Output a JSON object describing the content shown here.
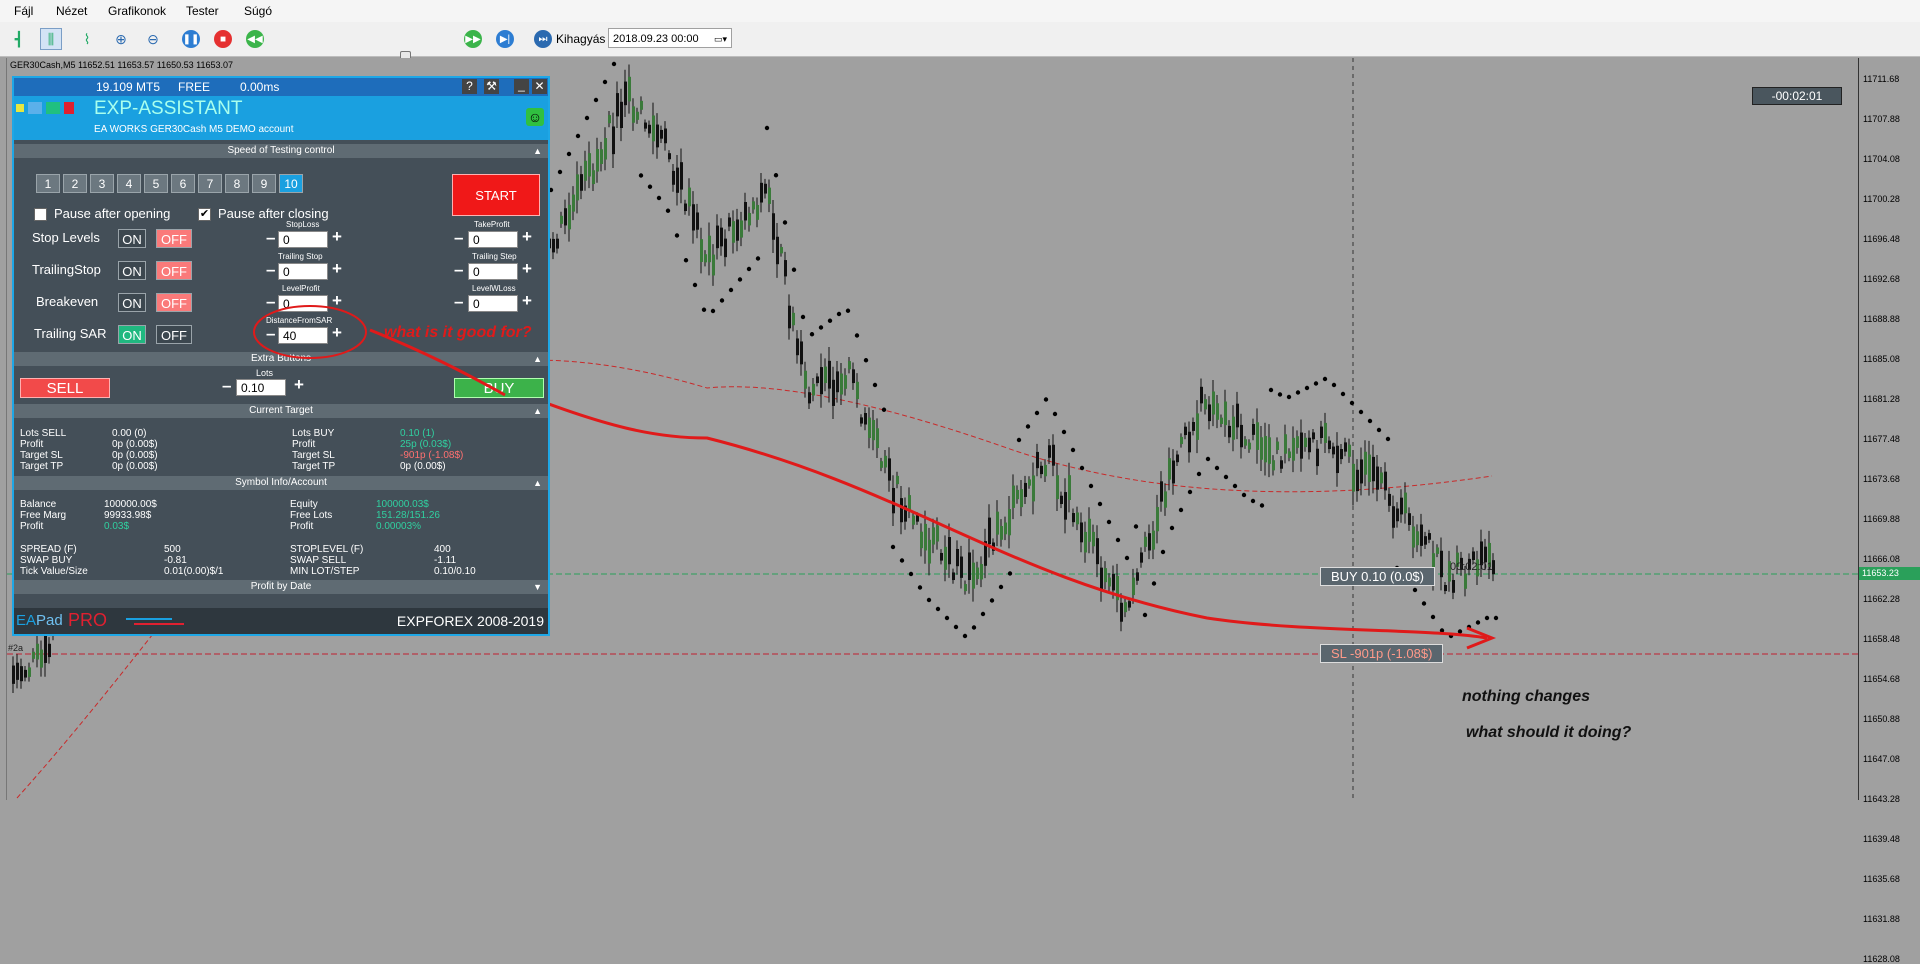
{
  "menu": [
    "Fájl",
    "Nézet",
    "Grafikonok",
    "Tester",
    "Súgó"
  ],
  "toolbar": {
    "skip_label": "Kihagyás",
    "date_value": "2018.09.23 00:00"
  },
  "chart": {
    "symbol_line": "GER30Cash,M5  11652.51 11653.57 11650.53 11653.07",
    "timer": "-00:02:01",
    "price_labels": [
      "11711.68",
      "11707.88",
      "11704.08",
      "11700.28",
      "11696.48",
      "11692.68",
      "11688.88",
      "11685.08",
      "11681.28",
      "11677.48",
      "11673.68",
      "11669.88",
      "11666.08",
      "11662.28",
      "11658.48",
      "11654.68",
      "11650.88",
      "11647.08",
      "11643.28",
      "11639.48",
      "11635.68",
      "11631.88",
      "11628.08"
    ],
    "current_price": "11653.23",
    "buy_label": "BUY 0.10 (0.0$)",
    "sl_label": "SL -901p (-1.08$)",
    "time_label": "00:02:01",
    "left_tag": "#2a"
  },
  "panel": {
    "topbar": {
      "version": "19.109 MT5",
      "license": "FREE",
      "latency": "0.00ms",
      "help": "?",
      "tools": "⚒",
      "min": "_",
      "close": "✕"
    },
    "title": "EXP-ASSISTANT",
    "subtitle": "EA WORKS GER30Cash  M5 DEMO account",
    "speed_header": "Speed of Testing control",
    "speeds": [
      "1",
      "2",
      "3",
      "4",
      "5",
      "6",
      "7",
      "8",
      "9",
      "10"
    ],
    "start_label": "START",
    "pause_open": "Pause after opening",
    "pause_close": "Pause after closing",
    "rows": [
      {
        "label": "Stop Levels",
        "left_mini": "StopLoss",
        "left_val": "0",
        "right_mini": "TakeProfit",
        "right_val": "0"
      },
      {
        "label": "TrailingStop",
        "left_mini": "Trailing Stop",
        "left_val": "0",
        "right_mini": "Trailing Step",
        "right_val": "0"
      },
      {
        "label": "Breakeven",
        "left_mini": "LevelProfit",
        "left_val": "0",
        "right_mini": "LevelWLoss",
        "right_val": "0"
      },
      {
        "label": "Trailing SAR",
        "left_mini": "DistanceFromSAR",
        "left_val": "40"
      }
    ],
    "on": "ON",
    "off": "OFF",
    "extra_header": "Extra Buttons",
    "lots_label": "Lots",
    "lots_value": "0.10",
    "sell": "SELL",
    "buy": "BUY",
    "target_header": "Current Target",
    "target_left": [
      [
        "Lots SELL",
        "0.00 (0)"
      ],
      [
        "Profit",
        "0p (0.00$)"
      ],
      [
        "Target SL",
        "0p (0.00$)"
      ],
      [
        "Target TP",
        "0p (0.00$)"
      ]
    ],
    "target_right": [
      [
        "Lots BUY",
        "0.10 (1)"
      ],
      [
        "Profit",
        "25p (0.03$)"
      ],
      [
        "Target SL",
        "-901p (-1.08$)"
      ],
      [
        "Target TP",
        "0p (0.00$)"
      ]
    ],
    "symbol_header": "Symbol Info/Account",
    "acct_left": [
      [
        "Balance",
        "100000.00$"
      ],
      [
        "Free Marg",
        "99933.98$"
      ],
      [
        "Profit",
        "0.03$"
      ]
    ],
    "acct_right": [
      [
        "Equity",
        "100000.03$"
      ],
      [
        "Free Lots",
        "151.28/151.26"
      ],
      [
        "Profit",
        "0.00003%"
      ]
    ],
    "sym_left": [
      [
        "SPREAD (F)",
        "500"
      ],
      [
        "SWAP BUY",
        "-0.81"
      ],
      [
        "Tick Value/Size",
        "0.01(0.00)$/1"
      ]
    ],
    "sym_right": [
      [
        "STOPLEVEL (F)",
        "400"
      ],
      [
        "SWAP SELL",
        "-1.11"
      ],
      [
        "MIN LOT/STEP",
        "0.10/0.10"
      ]
    ],
    "profit_header": "Profit by Date",
    "footer_brand_a": "EA",
    "footer_brand_b": "Pad",
    "footer_brand_c": "PRO",
    "footer_copy": "EXPFOREX 2008-2019"
  },
  "annotations": {
    "question": "what is it good for?",
    "nothing": "nothing changes",
    "should": "what should it doing?"
  },
  "colors": {
    "accent": "#1aa0e0",
    "panel_bg": "#444f58",
    "annotation_red": "#e01a1a"
  }
}
